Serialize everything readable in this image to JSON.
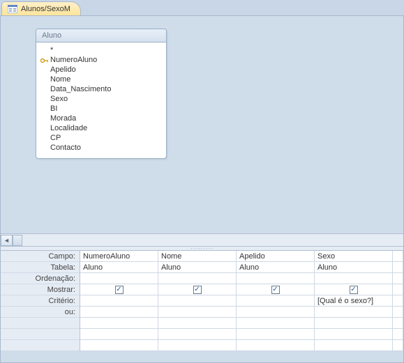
{
  "tab": {
    "title": "Alunos/SexoM"
  },
  "table": {
    "title": "Aluno",
    "fields": [
      {
        "name": "*",
        "pk": false
      },
      {
        "name": "NumeroAluno",
        "pk": true
      },
      {
        "name": "Apelido",
        "pk": false
      },
      {
        "name": "Nome",
        "pk": false
      },
      {
        "name": "Data_Nascimento",
        "pk": false
      },
      {
        "name": "Sexo",
        "pk": false
      },
      {
        "name": "BI",
        "pk": false
      },
      {
        "name": "Morada",
        "pk": false
      },
      {
        "name": "Localidade",
        "pk": false
      },
      {
        "name": "CP",
        "pk": false
      },
      {
        "name": "Contacto",
        "pk": false
      }
    ]
  },
  "rowLabels": {
    "campo": "Campo:",
    "tabela": "Tabela:",
    "ordenacao": "Ordenação:",
    "mostrar": "Mostrar:",
    "criterio": "Critério:",
    "ou": "ou:"
  },
  "columns": [
    {
      "campo": "NumeroAluno",
      "tabela": "Aluno",
      "ordenacao": "",
      "mostrar": true,
      "criterio": "",
      "ou": ""
    },
    {
      "campo": "Nome",
      "tabela": "Aluno",
      "ordenacao": "",
      "mostrar": true,
      "criterio": "",
      "ou": ""
    },
    {
      "campo": "Apelido",
      "tabela": "Aluno",
      "ordenacao": "",
      "mostrar": true,
      "criterio": "",
      "ou": ""
    },
    {
      "campo": "Sexo",
      "tabela": "Aluno",
      "ordenacao": "",
      "mostrar": true,
      "criterio": "[Qual é o sexo?]",
      "ou": ""
    }
  ],
  "glyphs": {
    "check": "✓",
    "left": "◄",
    "right": "►"
  }
}
